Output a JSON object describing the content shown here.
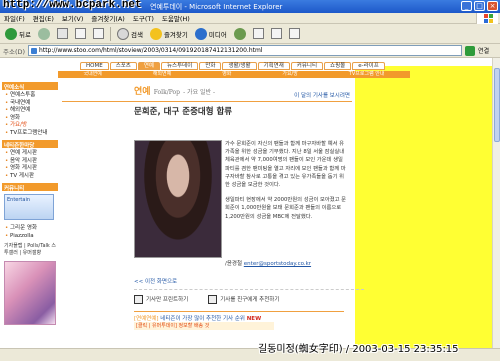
{
  "window": {
    "title": "연예투데이 - Microsoft Internet Explorer",
    "watermark_top": "http://www.bcpark.net"
  },
  "menubar": {
    "items": [
      "파일(F)",
      "편집(E)",
      "보기(V)",
      "즐겨찾기(A)",
      "도구(T)",
      "도움말(H)"
    ]
  },
  "toolbar": {
    "back_label": "뒤로",
    "search_label": "검색",
    "favorites_label": "즐겨찾기",
    "media_label": "미디어"
  },
  "addressbar": {
    "label": "주소(D)",
    "url": "http://www.stoo.com/html/stoview/2003/0314/091920187412131200.html",
    "links_label": "연결"
  },
  "site": {
    "top_nav": [
      "HOME",
      "스포츠",
      "연예",
      "뉴스투데이",
      "만화",
      "생활/생활",
      "기획연재",
      "커뮤니티",
      "쇼핑몰",
      "e-라이프"
    ],
    "active_top": "연예",
    "sub_nav": [
      "국내연예",
      "해외연예",
      "영화",
      "가요/방",
      "TV프로그램 안내"
    ]
  },
  "sidebar": {
    "news_header": "연예소식",
    "news_items": [
      "연예스투홈",
      "국내연예",
      "해외연예",
      "영화",
      "가요/방",
      "TV프로그램안내"
    ],
    "highlight": "가요/방",
    "board_header": "네티즌한마당",
    "board_items": [
      "연예 게시판",
      "음악 게시판",
      "영화 게시판",
      "TV 게시판"
    ],
    "entertainment_header": "커뮤니티",
    "banner_text": "Entertain",
    "extra_items": [
      "그리운 영화",
      "Piazzolla"
    ],
    "footer_links": "기자플랩 | Polls/Talk  스투갤러 | 유머갤향"
  },
  "article": {
    "section_logo": "연예",
    "section_sub": "Folk/Pop",
    "section_label": "- 가요 일반 -",
    "more_link": "이 달의 기사를 보시려면",
    "headline": "문희준, 대구 준중대형 합류",
    "paragraph_1": "가수 문희준이 자신의 팬들과 함께 마구자바할 예서 유가족을 위한 성금을 기부했다. 지난 8일 서울 잠실실내체육관에서 약 7,000여명의 팬들이 모인 가운데 생일파티를 겸한 팬미팅을 열고 자리에 모인 팬들과 함께 마구자바할 참사로 고통을 겪고 있는 유가족들을 돕기 위한 성금을 모금한 것이다.",
    "paragraph_2": "생일파티 현장에서 약 2000만원의 성금이 모아졌고 문희준이 1,000만원을 보태 문희준과 팬들의 이름으로 1,200만원의 성금을 MBC에 전달했다.",
    "byline_prefix": "/윤경철",
    "byline_email": "enter@sportstoday.co.kr",
    "prev_link": "<< 이전 화면으로",
    "print_label": "기사만 프린트하기",
    "email_label": "기사를 친구에게 추천하기",
    "related_label": "[연예연예]",
    "related_title": "네티즌이 가장 많이 추천한 기사 순위",
    "related_new": "NEW",
    "related_item": "[클릭 | 유머투데이] 정보할 배송 것"
  },
  "colors": {
    "accent": "#f29a2b",
    "highlight_band": "#ffff33",
    "titlebar": "#1d58c9"
  },
  "watermark_bottom": "길동미정(蜘女字印) / 2003-03-15 23:35:15"
}
